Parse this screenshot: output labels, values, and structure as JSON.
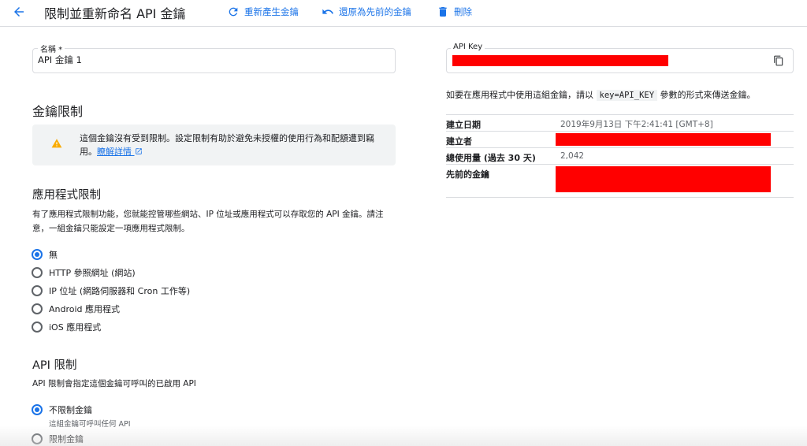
{
  "header": {
    "title": "限制並重新命名 API 金鑰",
    "back_icon": "arrow-back-icon",
    "regenerate_label": "重新產生金鑰",
    "revert_label": "還原為先前的金鑰",
    "delete_label": "刪除",
    "accent_color": "#1a73e8"
  },
  "name_field": {
    "label": "名稱 *",
    "value": "API 金鑰 1"
  },
  "key_restriction": {
    "heading": "金鑰限制",
    "warning_text": "這個金鑰沒有受到限制。設定限制有助於避免未授權的使用行為和配額遭到竊用。",
    "learn_more": "瞭解詳情"
  },
  "app_restriction": {
    "heading": "應用程式限制",
    "description": "有了應用程式限制功能，您就能控管哪些網站、IP 位址或應用程式可以存取您的 API 金鑰。請注意，一組金鑰只能設定一項應用程式限制。",
    "options": [
      {
        "label": "無",
        "selected": true
      },
      {
        "label": "HTTP 參照網址 (網站)",
        "selected": false
      },
      {
        "label": "IP 位址 (網路伺服器和 Cron 工作等)",
        "selected": false
      },
      {
        "label": "Android 應用程式",
        "selected": false
      },
      {
        "label": "iOS 應用程式",
        "selected": false
      }
    ]
  },
  "api_restriction": {
    "heading": "API 限制",
    "description": "API 限制會指定這個金鑰可呼叫的已啟用 API",
    "options": [
      {
        "label": "不限制金鑰",
        "sublabel": "這組金鑰可呼叫任何 API",
        "selected": true
      },
      {
        "label": "限制金鑰",
        "selected": false
      }
    ]
  },
  "api_key_panel": {
    "label": "API Key",
    "value": "",
    "copy_icon": "copy-icon",
    "usage_prefix": "如要在應用程式中使用這組金鑰，請以",
    "usage_code": "key=API_KEY",
    "usage_suffix": "參數的形式來傳送金鑰。",
    "redaction_color": "#ff0000"
  },
  "info": {
    "created_label": "建立日期",
    "created_value": "2019年9月13日 下午2:41:41 [GMT+8]",
    "creator_label": "建立者",
    "creator_value": "",
    "usage_label": "總使用量 (過去 30 天)",
    "usage_value": "2,042",
    "previous_label": "先前的金鑰",
    "previous_value": ""
  }
}
